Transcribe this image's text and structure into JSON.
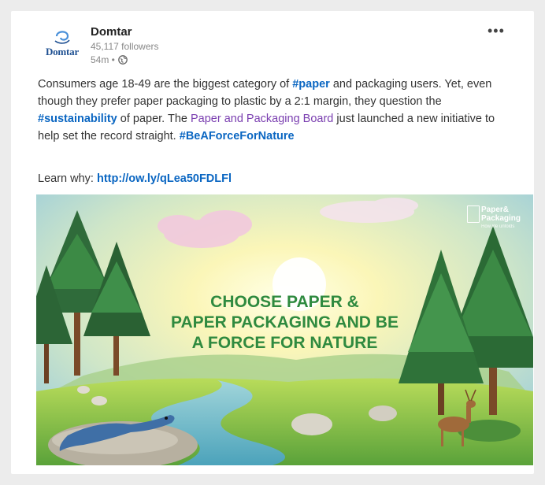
{
  "post": {
    "company": "Domtar",
    "logo_text": "Domtar",
    "followers": "45,117 followers",
    "time": "54m •",
    "more_icon": "more-dots-icon",
    "text": {
      "p1": "Consumers age 18-49 are the biggest category of ",
      "tag1": "#paper",
      "p2": " and packaging users. Yet, even though they prefer paper packaging to plastic by a 2:1 margin, they question the ",
      "tag2": "#sustainability",
      "p3": " of paper. The ",
      "board": "Paper and Packaging Board",
      "p4": " just launched a new initiative to help set the record straight. ",
      "tag3": "#BeAForceForNature"
    },
    "learn_label": "Learn why: ",
    "learn_link": "http://ow.ly/qLea50FDLFl"
  },
  "image": {
    "headline": [
      "CHOOSE PAPER &",
      "PAPER PACKAGING AND BE",
      "A FORCE FOR NATURE"
    ],
    "brand": {
      "line1": "Paper&",
      "line2": "Packaging",
      "tagline": "How life unfolds"
    }
  },
  "colors": {
    "link": "#0a66c2",
    "board": "#7a3eb0",
    "headline": "#2f8a3f",
    "logo": "#1d4f91"
  }
}
